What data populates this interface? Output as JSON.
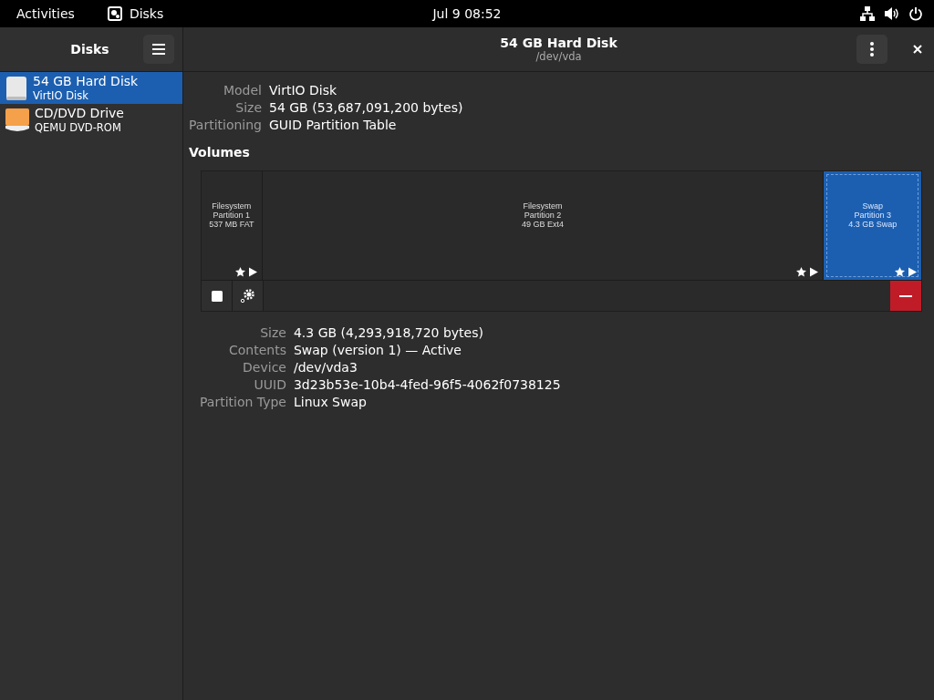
{
  "top_bar": {
    "activities": "Activities",
    "app_name": "Disks",
    "clock": "Jul 9  08:52"
  },
  "sidebar": {
    "title": "Disks",
    "items": [
      {
        "name": "54 GB Hard Disk",
        "subtitle": "VirtIO Disk",
        "kind": "hdd",
        "selected": true
      },
      {
        "name": "CD/DVD Drive",
        "subtitle": "QEMU DVD-ROM",
        "kind": "optical",
        "selected": false
      }
    ]
  },
  "header": {
    "title": "54 GB Hard Disk",
    "subtitle": "/dev/vda"
  },
  "disk_info": [
    {
      "label": "Model",
      "value": "VirtIO Disk"
    },
    {
      "label": "Size",
      "value": "54 GB (53,687,091,200 bytes)"
    },
    {
      "label": "Partitioning",
      "value": "GUID Partition Table"
    }
  ],
  "volumes": {
    "title": "Volumes",
    "partitions": [
      {
        "lines": [
          "Filesystem",
          "Partition 1",
          "537 MB FAT"
        ],
        "selected": false
      },
      {
        "lines": [
          "Filesystem",
          "Partition 2",
          "49 GB Ext4"
        ],
        "selected": false
      },
      {
        "lines": [
          "Swap",
          "Partition 3",
          "4.3 GB Swap"
        ],
        "selected": true
      }
    ]
  },
  "volume_info": [
    {
      "label": "Size",
      "value": "4.3 GB (4,293,918,720 bytes)"
    },
    {
      "label": "Contents",
      "value": "Swap (version 1) — Active"
    },
    {
      "label": "Device",
      "value": "/dev/vda3"
    },
    {
      "label": "UUID",
      "value": "3d23b53e-10b4-4fed-96f5-4062f0738125"
    },
    {
      "label": "Partition Type",
      "value": "Linux Swap"
    }
  ]
}
